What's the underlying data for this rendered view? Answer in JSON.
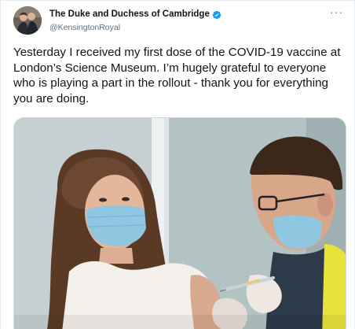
{
  "tweet": {
    "display_name": "The Duke and Duchess of Cambridge",
    "handle": "@KensingtonRoyal",
    "more_label": "···",
    "text": "Yesterday I received my first dose of the COVID-19 vaccine at London’s Science Museum. I’m hugely grateful to everyone who is playing a part in the rollout - thank you for everything you are doing.",
    "verified_icon": "verified-badge-icon",
    "more_icon": "more-options-icon"
  },
  "colors": {
    "text_primary": "#0f1419",
    "text_secondary": "#5b7083",
    "verified": "#1d9bf0",
    "border": "#e6ecf0"
  }
}
